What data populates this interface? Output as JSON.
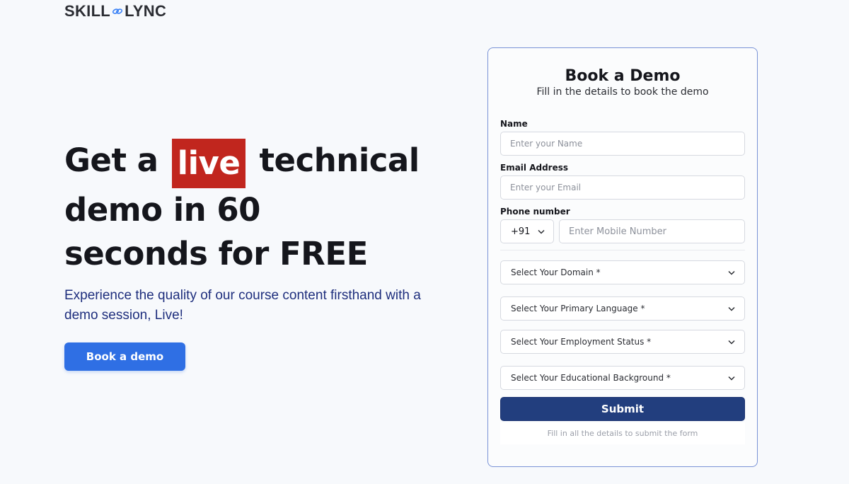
{
  "brand": {
    "logo_left": "SKILL",
    "logo_right": "LYNC",
    "accent": "#2f6fe4",
    "highlight": "#c1261e",
    "submit_color": "#223e7e"
  },
  "hero": {
    "headline_pre": "Get a",
    "headline_highlight": "live",
    "headline_post_1": "technical",
    "headline_line2": "demo in 60",
    "headline_line3": "seconds for FREE",
    "subtext": "Experience the quality of our course content firsthand with a demo session, Live!",
    "cta_label": "Book a demo"
  },
  "form": {
    "title": "Book a Demo",
    "subtitle": "Fill in the details to book the demo",
    "name": {
      "label": "Name",
      "placeholder": "Enter your Name"
    },
    "email": {
      "label": "Email Address",
      "placeholder": "Enter your Email"
    },
    "phone": {
      "label": "Phone number",
      "country_code": "+91",
      "placeholder": "Enter Mobile Number"
    },
    "dropdowns": [
      {
        "label": "Select Your Domain *"
      },
      {
        "label": "Select Your Primary Language *"
      },
      {
        "label": "Select Your Employment Status *"
      },
      {
        "label": "Select Your Educational Background *"
      }
    ],
    "submit_label": "Submit",
    "hint": "Fill in all the details to submit the form"
  }
}
